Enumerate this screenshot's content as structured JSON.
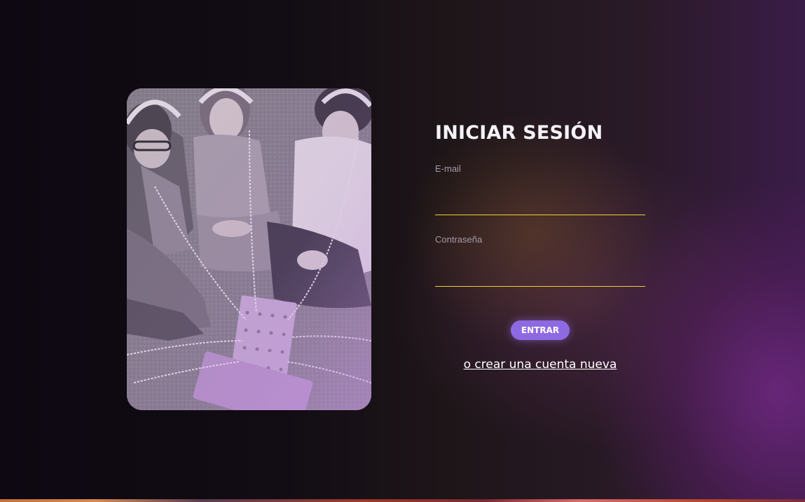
{
  "login": {
    "title": "INICIAR SESIÓN",
    "email_label": "E-mail",
    "email_value": "",
    "password_label": "Contraseña",
    "password_value": "",
    "submit_label": "ENTRAR",
    "create_account_link": "o crear una cuenta nueva"
  },
  "photo": {
    "subject": "group of young people wearing headphones sitting on the floor around a device"
  },
  "colors": {
    "accent_button": "#8e6ae2",
    "input_underline": "#f0cc3a",
    "title_text": "#f4f2f6",
    "label_text": "#a69aa5",
    "background_dark": "#0e0913",
    "background_purple": "#702882"
  }
}
